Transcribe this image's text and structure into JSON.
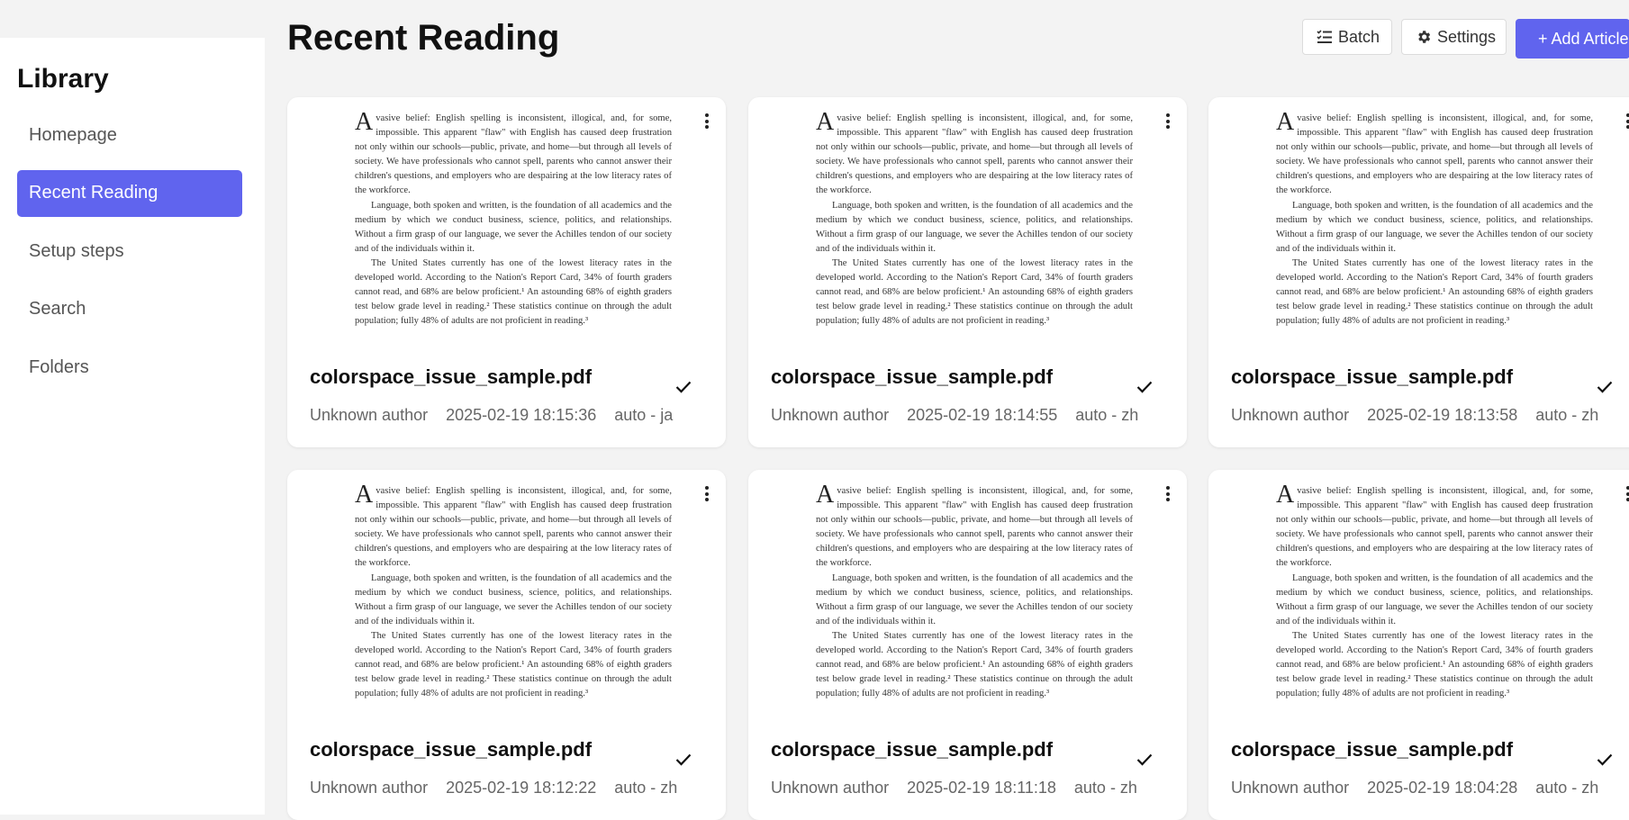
{
  "sidebar": {
    "title": "Library",
    "items": [
      {
        "label": "Homepage",
        "active": false
      },
      {
        "label": "Recent Reading",
        "active": true
      },
      {
        "label": "Setup steps",
        "active": false
      },
      {
        "label": "Search",
        "active": false
      },
      {
        "label": "Folders",
        "active": false
      }
    ]
  },
  "header": {
    "title": "Recent Reading",
    "batch_label": "Batch",
    "settings_label": "Settings",
    "add_label": "+ Add Article"
  },
  "colors": {
    "accent": "#6064ee"
  },
  "preview_text": {
    "p1": "vasive belief: English spelling is inconsistent, illogical, and, for some, impossible. This apparent \"flaw\" with English has caused deep frustration not only within our schools—public, private, and home—but through all levels of society. We have professionals who cannot spell, parents who cannot answer their children's questions, and employers who are despairing at the low literacy rates of the workforce.",
    "p2": "Language, both spoken and written, is the foundation of all academics and the medium by which we conduct business, science, politics, and relationships. Without a firm grasp of our language, we sever the Achilles tendon of our society and of the individuals within it.",
    "p3": "The United States currently has one of the lowest literacy rates in the developed world. According to the Nation's Report Card, 34% of fourth graders cannot read, and 68% are below proficient.¹ An astounding 68% of eighth graders test below grade level in reading.² These statistics continue on through the adult population; fully 48% of adults are not proficient in reading.³"
  },
  "cards": [
    {
      "title": "colorspace_issue_sample.pdf",
      "author": "Unknown author",
      "date": "2025-02-19 18:15:36",
      "lang": "auto - ja"
    },
    {
      "title": "colorspace_issue_sample.pdf",
      "author": "Unknown author",
      "date": "2025-02-19 18:14:55",
      "lang": "auto - zh"
    },
    {
      "title": "colorspace_issue_sample.pdf",
      "author": "Unknown author",
      "date": "2025-02-19 18:13:58",
      "lang": "auto - zh"
    },
    {
      "title": "colorspace_issue_sample.pdf",
      "author": "Unknown author",
      "date": "2025-02-19 18:12:22",
      "lang": "auto - zh"
    },
    {
      "title": "colorspace_issue_sample.pdf",
      "author": "Unknown author",
      "date": "2025-02-19 18:11:18",
      "lang": "auto - zh"
    },
    {
      "title": "colorspace_issue_sample.pdf",
      "author": "Unknown author",
      "date": "2025-02-19 18:04:28",
      "lang": "auto - zh"
    }
  ]
}
